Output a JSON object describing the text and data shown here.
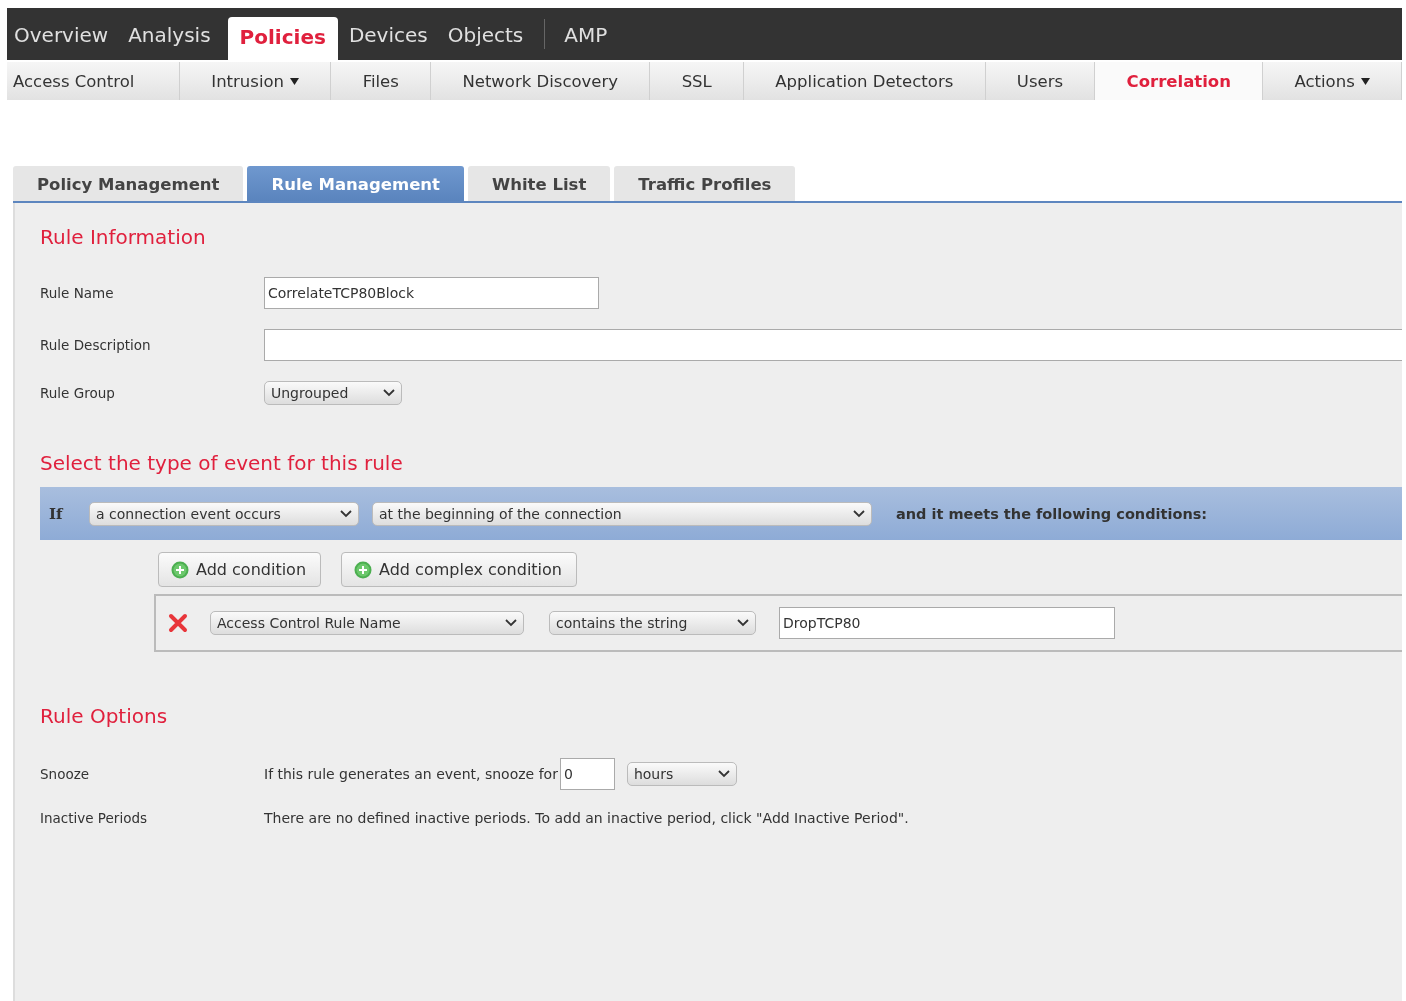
{
  "main_nav": [
    {
      "label": "Overview",
      "selected": false,
      "divider_before": false
    },
    {
      "label": "Analysis",
      "selected": false,
      "divider_before": false
    },
    {
      "label": "Policies",
      "selected": true,
      "divider_before": false
    },
    {
      "label": "Devices",
      "selected": false,
      "divider_before": false
    },
    {
      "label": "Objects",
      "selected": false,
      "divider_before": false
    },
    {
      "label": "AMP",
      "selected": false,
      "divider_before": true
    }
  ],
  "sub_nav": [
    {
      "label": "Access Control",
      "selected": false,
      "has_menu": false
    },
    {
      "label": "Intrusion",
      "selected": false,
      "has_menu": true
    },
    {
      "label": "Files",
      "selected": false,
      "has_menu": false
    },
    {
      "label": "Network Discovery",
      "selected": false,
      "has_menu": false
    },
    {
      "label": "SSL",
      "selected": false,
      "has_menu": false
    },
    {
      "label": "Application Detectors",
      "selected": false,
      "has_menu": false
    },
    {
      "label": "Users",
      "selected": false,
      "has_menu": false
    },
    {
      "label": "Correlation",
      "selected": true,
      "has_menu": false
    },
    {
      "label": "Actions",
      "selected": false,
      "has_menu": true
    }
  ],
  "tabs": [
    {
      "label": "Policy Management",
      "selected": false
    },
    {
      "label": "Rule Management",
      "selected": true
    },
    {
      "label": "White List",
      "selected": false
    },
    {
      "label": "Traffic Profiles",
      "selected": false
    }
  ],
  "rule_information": {
    "heading": "Rule Information",
    "fields": [
      {
        "label": "Rule Name",
        "kind": "text",
        "value": "CorrelateTCP80Block"
      },
      {
        "label": "Rule Description",
        "kind": "wide_text"
      },
      {
        "label": "Rule Group",
        "kind": "select",
        "value": "Ungrouped"
      }
    ]
  },
  "event_section": {
    "heading": "Select the type of event for this rule",
    "if_label": "If",
    "event_type": "a connection event occurs",
    "event_timing": "at the beginning of the connection",
    "suffix": "and it meets the following conditions:",
    "buttons": [
      "Add condition",
      "Add complex condition"
    ],
    "conditions": [
      {
        "field": "Access Control Rule Name",
        "operator": "contains the string",
        "value": "DropTCP80"
      }
    ]
  },
  "rule_options": {
    "heading": "Rule Options",
    "snooze": {
      "label": "Snooze",
      "text": "If this rule generates an event, snooze for",
      "value": "0",
      "unit": "hours"
    },
    "inactive_periods": {
      "label": "Inactive Periods",
      "text": "There are no defined inactive periods. To add an inactive period, click \"Add Inactive Period\"."
    }
  }
}
